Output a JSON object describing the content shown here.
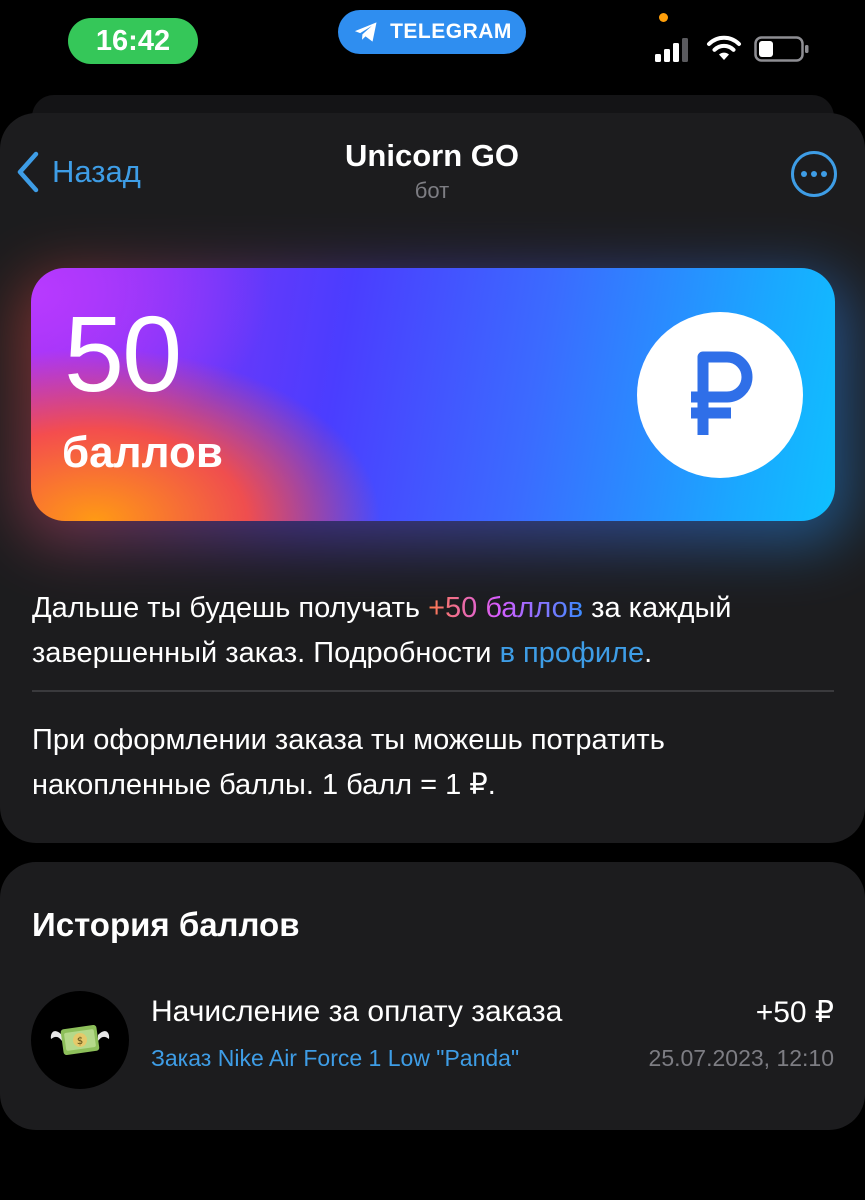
{
  "status_bar": {
    "time": "16:42",
    "app_indicator": "TELEGRAM"
  },
  "nav": {
    "back_label": "Назад",
    "title": "Unicorn GO",
    "subtitle": "бот"
  },
  "points": {
    "value": "50",
    "unit": "баллов",
    "currency_symbol": "₽"
  },
  "description": {
    "part1": "Дальше ты будешь получать ",
    "highlight": "+50 баллов",
    "part2": " за каждый завершенный заказ. Подробности ",
    "link": "в профиле",
    "part3": "."
  },
  "info": "При оформлении заказа ты можешь потратить накопленные баллы. 1 балл = 1 ₽.",
  "history": {
    "title": "История баллов",
    "items": [
      {
        "icon": "flying-money-icon",
        "title": "Начисление за оплату заказа",
        "order": "Заказ Nike Air Force 1 Low \"Panda\"",
        "amount": "+50 ₽",
        "date": "25.07.2023, 12:10"
      }
    ]
  },
  "colors": {
    "accent_blue": "#3e9de6",
    "card_bg": "#1c1c1e",
    "time_pill": "#35c759",
    "telegram_pill": "#2f8ef0"
  }
}
